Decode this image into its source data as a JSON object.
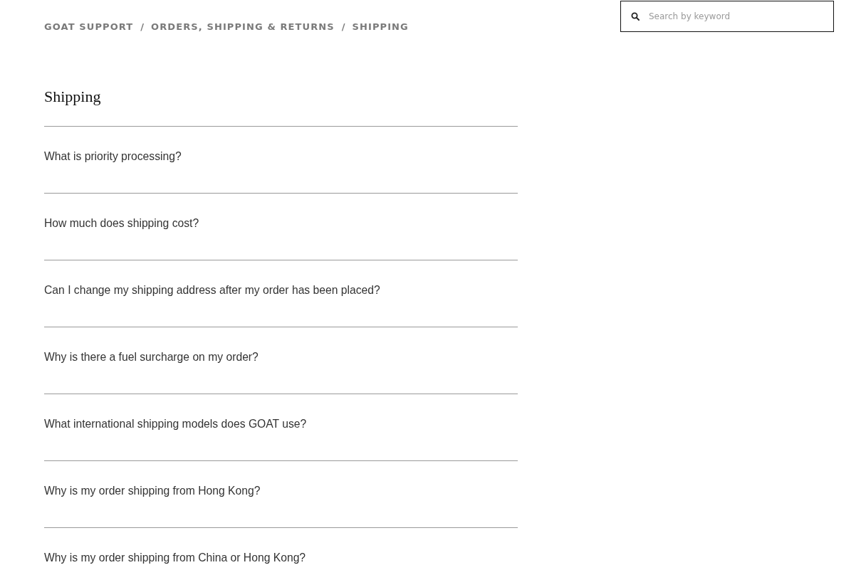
{
  "breadcrumb": [
    {
      "label": "GOAT SUPPORT",
      "separator": "/"
    },
    {
      "label": "ORDERS, SHIPPING & RETURNS",
      "separator": "/"
    },
    {
      "label": "SHIPPING"
    }
  ],
  "search": {
    "placeholder": "Search by keyword"
  },
  "section": {
    "title": "Shipping",
    "questions": [
      "What is priority processing?",
      "How much does shipping cost?",
      "Can I change my shipping address after my order has been placed?",
      "Why is there a fuel surcharge on my order?",
      "What international shipping models does GOAT use?",
      "Why is my order shipping from Hong Kong?",
      "Why is my order shipping from China or Hong Kong?"
    ]
  }
}
